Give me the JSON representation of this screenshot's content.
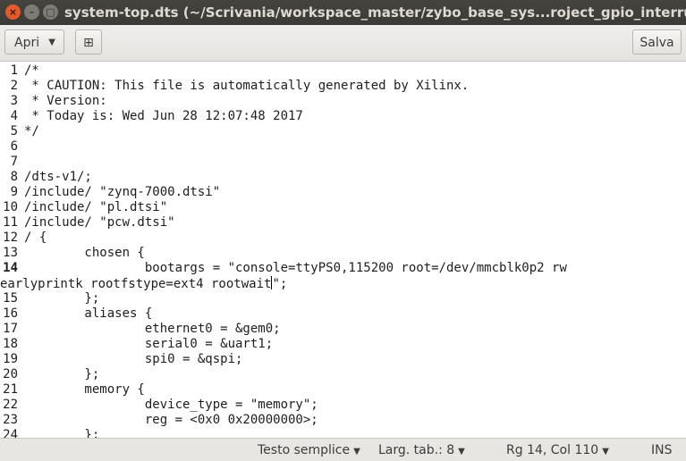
{
  "window": {
    "title": "system-top.dts (~/Scrivania/workspace_master/zybo_base_sys...roject_gpio_interrupt.sdk/devi",
    "close_glyph": "×",
    "min_glyph": "–",
    "max_glyph": "□"
  },
  "toolbar": {
    "open_label": "Apri",
    "new_tab_glyph": "⊞",
    "save_label": "Salva"
  },
  "editor": {
    "current_line": 14,
    "lines": [
      {
        "num": "1",
        "text": "/*"
      },
      {
        "num": "2",
        "text": " * CAUTION: This file is automatically generated by Xilinx."
      },
      {
        "num": "3",
        "text": " * Version:"
      },
      {
        "num": "4",
        "text": " * Today is: Wed Jun 28 12:07:48 2017"
      },
      {
        "num": "5",
        "text": "*/"
      },
      {
        "num": "6",
        "text": ""
      },
      {
        "num": "7",
        "text": ""
      },
      {
        "num": "8",
        "text": "/dts-v1/;"
      },
      {
        "num": "9",
        "text": "/include/ \"zynq-7000.dtsi\""
      },
      {
        "num": "10",
        "text": "/include/ \"pl.dtsi\""
      },
      {
        "num": "11",
        "text": "/include/ \"pcw.dtsi\""
      },
      {
        "num": "12",
        "text": "/ {"
      },
      {
        "num": "13",
        "text": "        chosen {"
      },
      {
        "num": "14",
        "text": "                bootargs = \"console=ttyPS0,115200 root=/dev/mmcblk0p2 rw"
      },
      {
        "num": "",
        "text_a": "earlyprintk rootfstype=ext4 rootwait",
        "text_b": "\";"
      },
      {
        "num": "15",
        "text": "        };"
      },
      {
        "num": "16",
        "text": "        aliases {"
      },
      {
        "num": "17",
        "text": "                ethernet0 = &gem0;"
      },
      {
        "num": "18",
        "text": "                serial0 = &uart1;"
      },
      {
        "num": "19",
        "text": "                spi0 = &qspi;"
      },
      {
        "num": "20",
        "text": "        };"
      },
      {
        "num": "21",
        "text": "        memory {"
      },
      {
        "num": "22",
        "text": "                device_type = \"memory\";"
      },
      {
        "num": "23",
        "text": "                reg = <0x0 0x20000000>;"
      },
      {
        "num": "24",
        "text": "        };"
      }
    ]
  },
  "statusbar": {
    "syntax": "Testo semplice",
    "tab_width": "Larg. tab.: 8",
    "position": "Rg 14, Col 110",
    "mode": "INS"
  }
}
